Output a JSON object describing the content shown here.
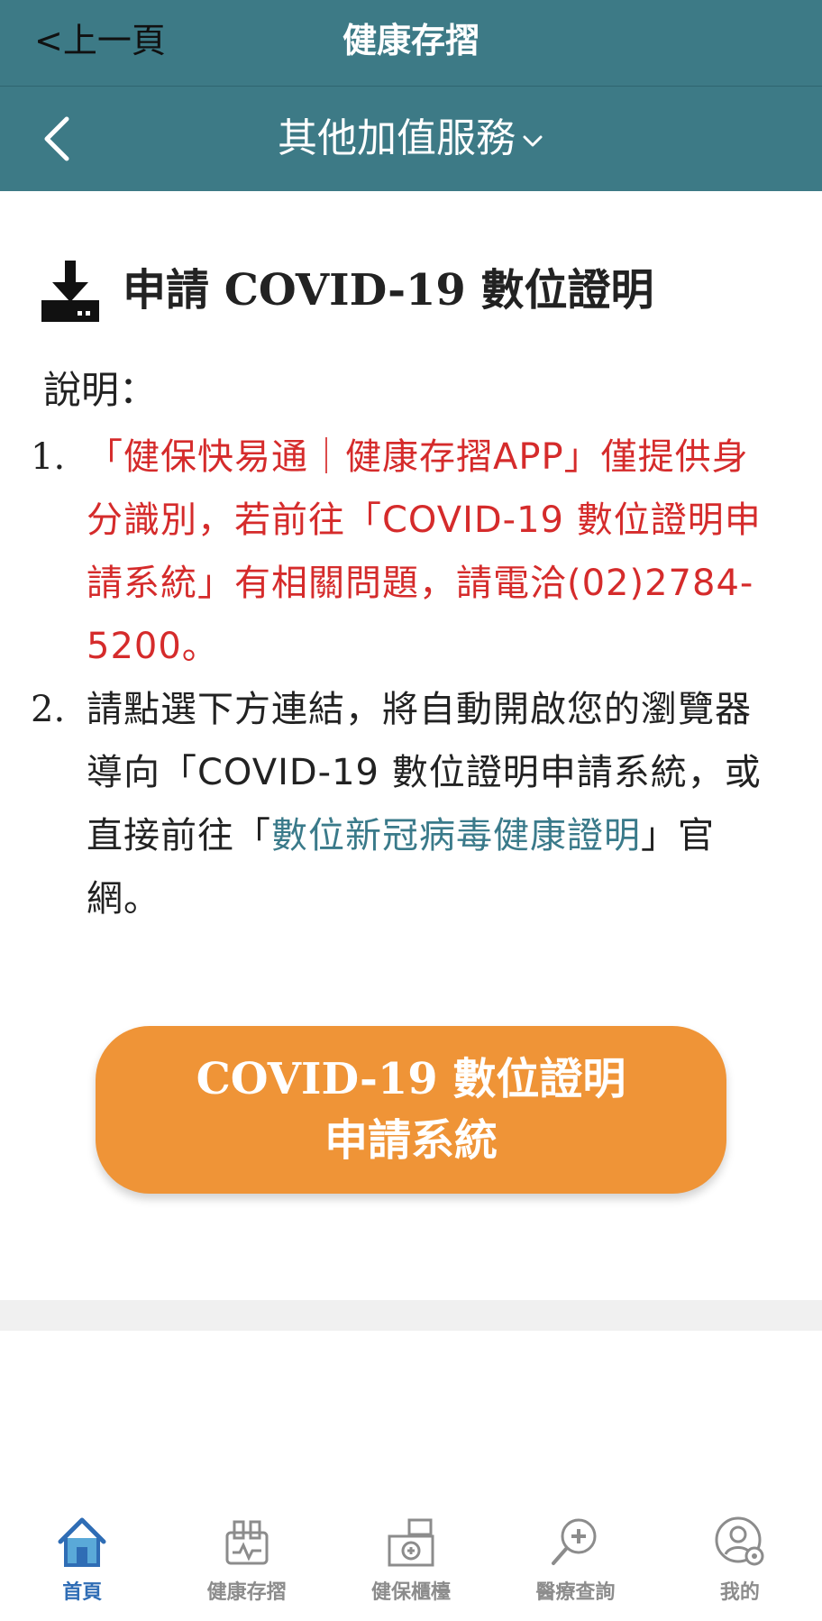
{
  "topbar": {
    "back_label": "<上一頁",
    "title": "健康存摺"
  },
  "subbar": {
    "section": "其他加值服務"
  },
  "heading": {
    "title": "申請 COVID-19 數位證明"
  },
  "description": {
    "label": "說明：",
    "items": [
      {
        "num": "1.",
        "text": "「健保快易通｜健康存摺APP」僅提供身分識別，若前往「COVID-19 數位證明申請系統」有相關問題，請電洽(02)2784-5200。"
      },
      {
        "num": "2.",
        "text_before": "請點選下方連結，將自動開啟您的瀏覽器導向「COVID-19 數位證明申請系統，或直接前往「",
        "link": "數位新冠病毒健康證明",
        "text_after": "」官網。"
      }
    ]
  },
  "cta": {
    "line1": "COVID-19 數位證明",
    "line2": "申請系統"
  },
  "tabs": [
    {
      "label": "首頁",
      "icon": "home-icon",
      "active": true
    },
    {
      "label": "健康存摺",
      "icon": "health-passbook-icon",
      "active": false
    },
    {
      "label": "健保櫃檯",
      "icon": "counter-icon",
      "active": false
    },
    {
      "label": "醫療查詢",
      "icon": "medical-search-icon",
      "active": false
    },
    {
      "label": "我的",
      "icon": "profile-settings-icon",
      "active": false
    }
  ],
  "colors": {
    "header": "#3d7a86",
    "alert_text": "#d52b2b",
    "link": "#3a7a8a",
    "cta": "#ef9437",
    "active_tab": "#2f6db5"
  }
}
